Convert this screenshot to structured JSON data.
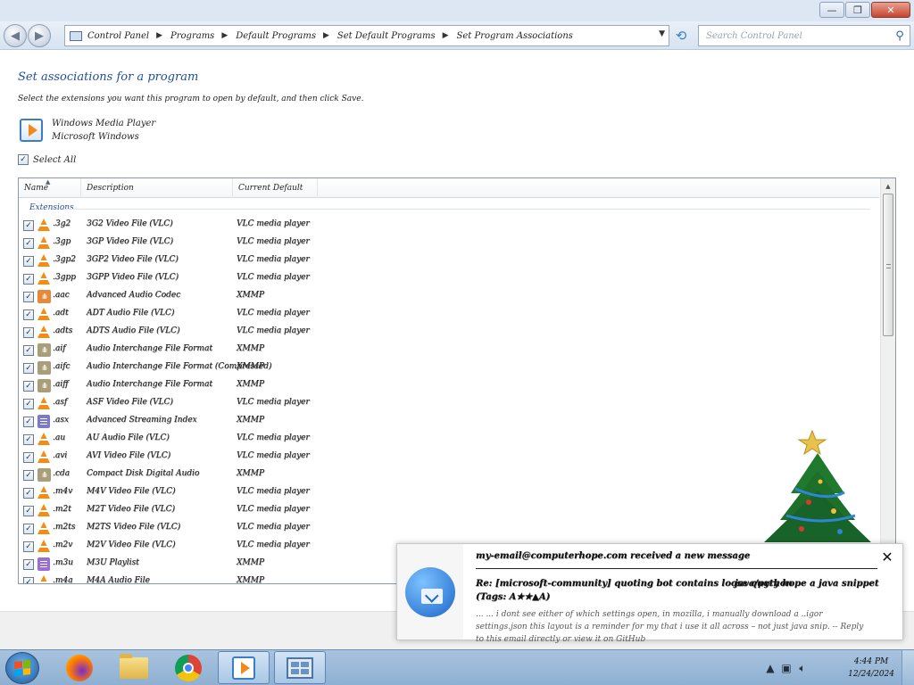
{
  "window": {
    "buttons": {
      "minimize": "—",
      "maximize": "❐",
      "close": "✕"
    }
  },
  "navbar": {
    "breadcrumbs": [
      "Control Panel",
      "Programs",
      "Default Programs",
      "Set Default Programs",
      "Set Program Associations"
    ],
    "search_placeholder": "Search Control Panel"
  },
  "page": {
    "heading": "Set associations for a program",
    "instruction": "Select the extensions you want this program to open by default, and then click Save.",
    "program_name": "Windows Media Player",
    "publisher": "Microsoft Windows",
    "select_all_label": "Select All",
    "select_all_checked": true
  },
  "list": {
    "columns": [
      "Name",
      "Description",
      "Current Default"
    ],
    "group_label": "Extensions",
    "rows": [
      {
        "icon": "vlc-cone-icon",
        "name": ".3g2",
        "description": "3G2 Video File (VLC)",
        "current": "VLC media player",
        "checked": true
      },
      {
        "icon": "vlc-cone-icon",
        "name": ".3gp",
        "description": "3GP Video File (VLC)",
        "current": "VLC media player",
        "checked": true
      },
      {
        "icon": "vlc-cone-icon",
        "name": ".3gp2",
        "description": "3GP2 Video File (VLC)",
        "current": "VLC media player",
        "checked": true
      },
      {
        "icon": "vlc-cone-icon",
        "name": ".3gpp",
        "description": "3GPP Video File (VLC)",
        "current": "VLC media player",
        "checked": true
      },
      {
        "icon": "audio-orange-icon",
        "name": ".aac",
        "description": "Advanced Audio Codec",
        "current": "XMMP",
        "checked": true
      },
      {
        "icon": "vlc-cone-icon",
        "name": ".adt",
        "description": "ADT Audio File (VLC)",
        "current": "VLC media player",
        "checked": true
      },
      {
        "icon": "vlc-cone-icon",
        "name": ".adts",
        "description": "ADTS Audio File (VLC)",
        "current": "VLC media player",
        "checked": true
      },
      {
        "icon": "audio-icon",
        "name": ".aif",
        "description": "Audio Interchange File Format",
        "current": "XMMP",
        "checked": true
      },
      {
        "icon": "audio-icon",
        "name": ".aifc",
        "description": "Audio Interchange File Format (Compressed)",
        "current": "XMMP",
        "checked": true
      },
      {
        "icon": "audio-icon",
        "name": ".aiff",
        "description": "Audio Interchange File Format",
        "current": "XMMP",
        "checked": true
      },
      {
        "icon": "vlc-cone-icon",
        "name": ".asf",
        "description": "ASF Video File (VLC)",
        "current": "VLC media player",
        "checked": true
      },
      {
        "icon": "document-icon",
        "name": ".asx",
        "description": "Advanced Streaming Index",
        "current": "XMMP",
        "checked": true
      },
      {
        "icon": "vlc-cone-icon",
        "name": ".au",
        "description": "AU Audio File (VLC)",
        "current": "VLC media player",
        "checked": true
      },
      {
        "icon": "vlc-cone-icon",
        "name": ".avi",
        "description": "AVI Video File (VLC)",
        "current": "VLC media player",
        "checked": true
      },
      {
        "icon": "audio-icon",
        "name": ".cda",
        "description": "Compact Disk Digital Audio",
        "current": "XMMP",
        "checked": true
      },
      {
        "icon": "vlc-cone-icon",
        "name": ".m4v",
        "description": "M4V Video File (VLC)",
        "current": "VLC media player",
        "checked": true
      },
      {
        "icon": "vlc-cone-icon",
        "name": ".m2t",
        "description": "M2T Video File (VLC)",
        "current": "VLC media player",
        "checked": true
      },
      {
        "icon": "vlc-cone-icon",
        "name": ".m2ts",
        "description": "M2TS Video File (VLC)",
        "current": "VLC media player",
        "checked": true
      },
      {
        "icon": "vlc-cone-icon",
        "name": ".m2v",
        "description": "M2V Video File (VLC)",
        "current": "VLC media player",
        "checked": true
      },
      {
        "icon": "playlist-icon",
        "name": ".m3u",
        "description": "M3U Playlist",
        "current": "XMMP",
        "checked": true
      },
      {
        "icon": "vlc-cone-icon",
        "name": ".m4a",
        "description": "M4A Audio File",
        "current": "XMMP",
        "checked": true
      }
    ]
  },
  "notification": {
    "header": "my-email@computerhope.com received a new message",
    "subject": "Re: [microsoft-community] quoting bot contains loose query hope a java snippet",
    "subject_tag": "java/python",
    "subject_line2": "(Tags: A★★▲A)",
    "body": "... ... i dont see either of which settings open, in mozilla, i manually download a ..igor settings.json  this layout is a reminder for my that i use it all across – not just java snip. -- Reply to this email directly or view it on GitHub",
    "close": "✕"
  },
  "taskbar": {
    "clock_time": "4:44 PM",
    "clock_date": "12/24/2024"
  }
}
